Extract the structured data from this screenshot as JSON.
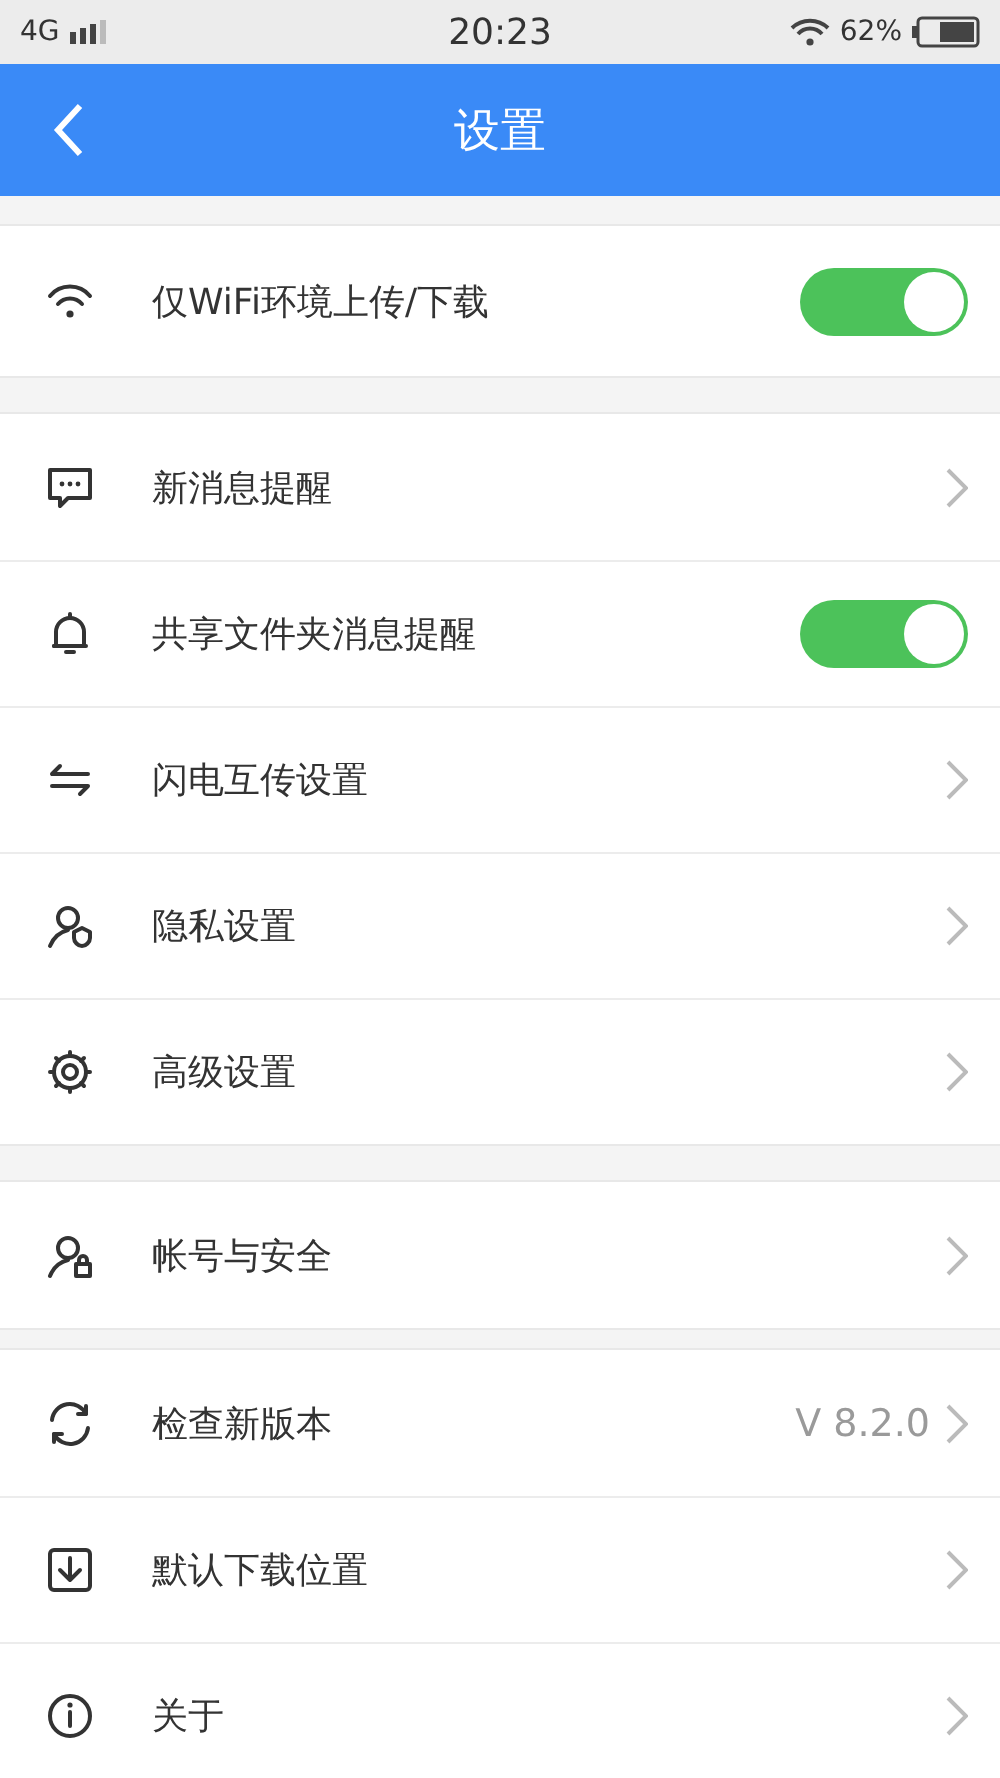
{
  "status_bar": {
    "network": "4G",
    "time": "20:23",
    "battery": "62%"
  },
  "nav_bar": {
    "title": "设置"
  },
  "sections": [
    {
      "items": [
        {
          "kind": "toggle",
          "label": "仅WiFi环境上传/下载",
          "on": true
        }
      ]
    },
    {
      "items": [
        {
          "kind": "link",
          "label": "新消息提醒"
        },
        {
          "kind": "toggle",
          "label": "共享文件夹消息提醒",
          "on": true
        },
        {
          "kind": "link",
          "label": "闪电互传设置"
        },
        {
          "kind": "link",
          "label": "隐私设置"
        },
        {
          "kind": "link",
          "label": "高级设置"
        }
      ]
    },
    {
      "items": [
        {
          "kind": "link",
          "label": "帐号与安全"
        }
      ]
    },
    {
      "items": [
        {
          "kind": "link",
          "label": "检查新版本",
          "value": "V 8.2.0"
        },
        {
          "kind": "link",
          "label": "默认下载位置"
        },
        {
          "kind": "link",
          "label": "关于"
        }
      ]
    }
  ]
}
